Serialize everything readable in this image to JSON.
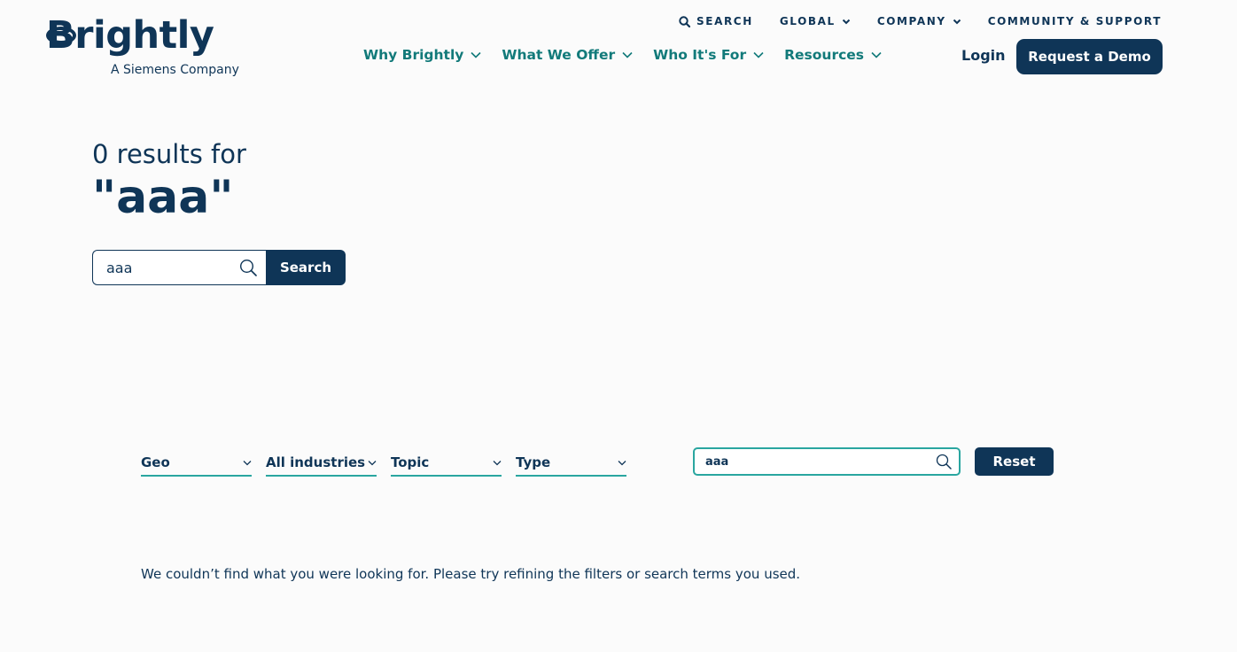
{
  "header": {
    "logo_text": "Brightly",
    "logo_subtitle": "A Siemens Company",
    "utility_nav": [
      {
        "label": "Search"
      },
      {
        "label": "Global"
      },
      {
        "label": "Company"
      },
      {
        "label": "Community & Support"
      }
    ],
    "main_nav": [
      {
        "label": "Why Brightly"
      },
      {
        "label": "What We Offer"
      },
      {
        "label": "Who It's For"
      },
      {
        "label": "Resources"
      }
    ],
    "login_label": "Login",
    "demo_label": "Request a Demo"
  },
  "results": {
    "count_text": "0 results for",
    "query_text": "\"aaa\"",
    "search_value": "aaa",
    "search_button": "Search"
  },
  "filters": {
    "dropdowns": [
      {
        "label": "Geo"
      },
      {
        "label": "All industries"
      },
      {
        "label": "Topic"
      },
      {
        "label": "Type"
      }
    ],
    "search_value": "aaa",
    "reset_label": "Reset"
  },
  "empty_message": "We couldn’t find what you were looking for. Please try refining the filters or search terms you used.",
  "colors": {
    "navy": "#0f3557",
    "teal": "#127a7a",
    "accent_border": "#2aa6a0",
    "background": "#fbfbfb"
  },
  "icons": {
    "utility_search": "magnifier-icon",
    "dropdown": "chevron-down-icon",
    "input_search": "magnifier-icon"
  }
}
